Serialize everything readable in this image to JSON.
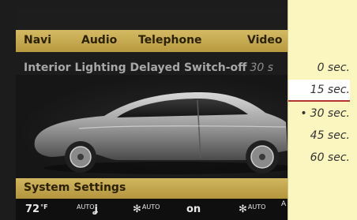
{
  "menu": {
    "items": [
      "Navi",
      "Audio",
      "Telephone",
      "Video"
    ]
  },
  "setting": {
    "title": "Interior Lighting Delayed Switch-off",
    "current": "30 s"
  },
  "system_bar": {
    "label": "System Settings"
  },
  "climate": {
    "temp_left": "72",
    "temp_unit": "°F",
    "seat_left": "AUTO",
    "fan_left": "AUTO",
    "ac_status": "on",
    "fan_right": "AUTO",
    "right_cut": "A"
  },
  "options": {
    "items": [
      "0 sec.",
      "15 sec.",
      "30 sec.",
      "45 sec.",
      "60 sec."
    ],
    "selected_marker": "•"
  },
  "colors": {
    "menu_bar": "#c8ad55",
    "side_panel": "#fbf6c0",
    "highlight_line": "#b5342d"
  }
}
